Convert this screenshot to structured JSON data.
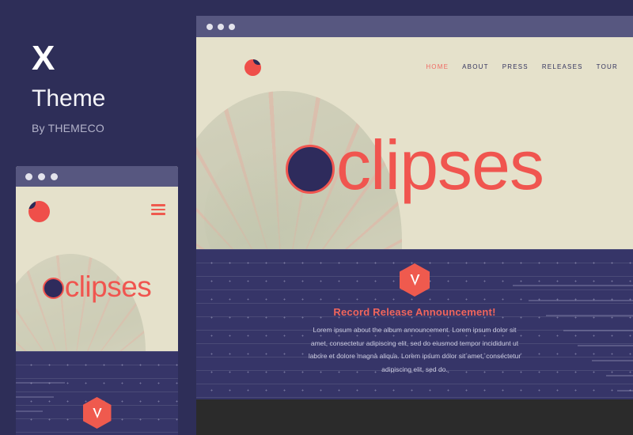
{
  "brand": {
    "logo_letter": "X",
    "name": "Theme",
    "author": "By THEMECO"
  },
  "colors": {
    "page_background": "#2e2e58",
    "accent_coral": "#ef5a4e",
    "deep_navy": "#2e2b5c",
    "cream": "#e5e1cb",
    "section_navy": "#363568",
    "titlebar": "#575780",
    "footer": "#2b2b2b"
  },
  "desktop_mockup": {
    "titlebar": {
      "dots": [
        "dot-1",
        "dot-2",
        "dot-3"
      ]
    },
    "hero": {
      "logo_icon": "eclipse-logo-icon",
      "nav": [
        {
          "label": "HOME",
          "active": true
        },
        {
          "label": "ABOUT",
          "active": false
        },
        {
          "label": "PRESS",
          "active": false
        },
        {
          "label": "RELEASES",
          "active": false
        },
        {
          "label": "TOUR",
          "active": false
        }
      ],
      "title_text": "clipses",
      "title_full": "eclipses"
    },
    "announcement": {
      "badge_icon": "hexagon-bird-badge-icon",
      "heading": "Record Release Announcement!",
      "body": "Lorem ipsum about the album announcement. Lorem ipsum dolor sit amet, consectetur adipiscing elit, sed do eiusmod tempor incididunt ut labore et dolore magna aliqua. Lorem ipsum dolor sit amet, consectetur adipiscing elit, sed do."
    }
  },
  "mobile_mockup": {
    "titlebar": {
      "dots": [
        "dot-1",
        "dot-2",
        "dot-3"
      ]
    },
    "hero": {
      "logo_icon": "eclipse-logo-icon",
      "menu_icon": "hamburger-menu-icon",
      "title_text": "clipses",
      "title_full": "eclipses"
    },
    "badge_icon": "hexagon-bird-badge-icon"
  }
}
